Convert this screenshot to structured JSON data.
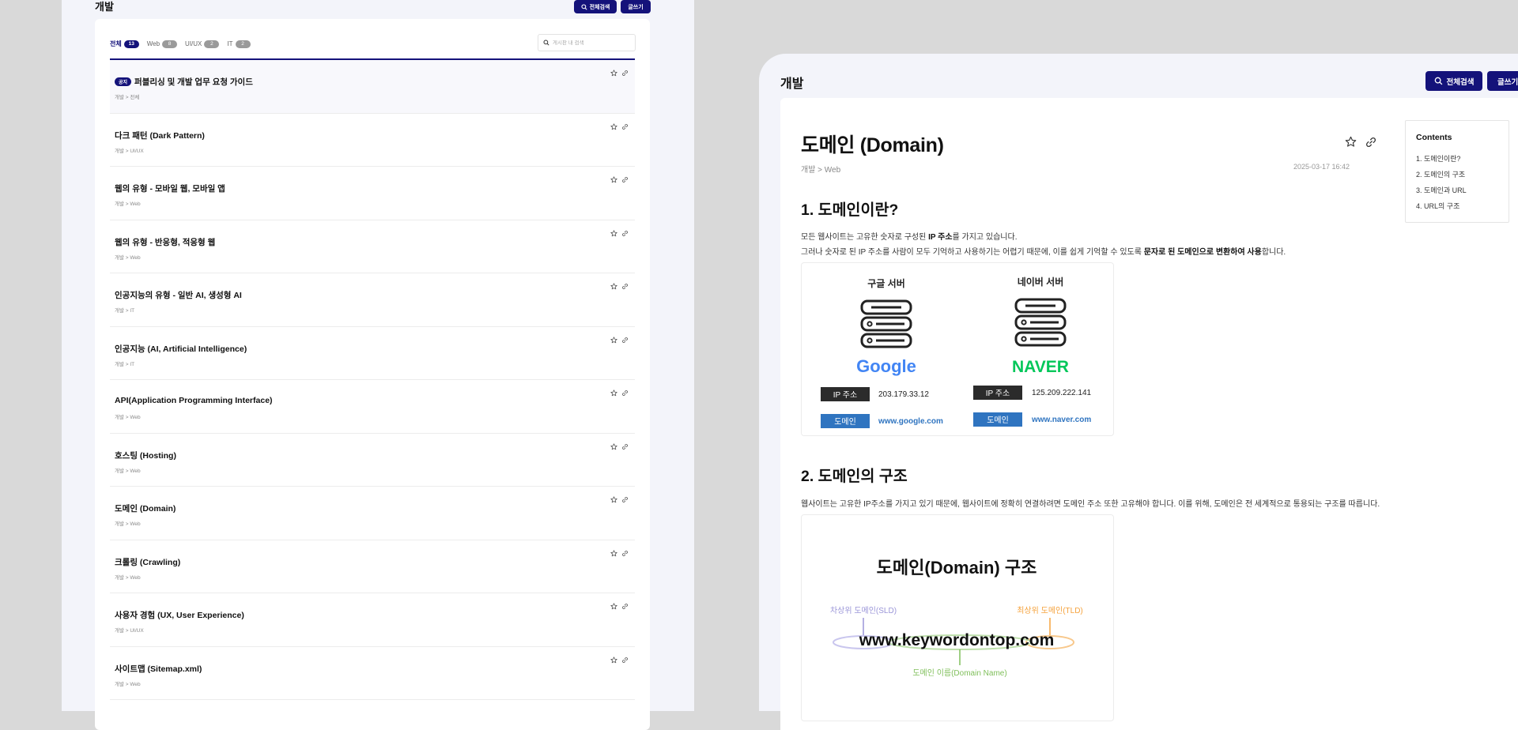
{
  "left": {
    "title": "개발",
    "search_button": "전체검색",
    "write_button": "글쓰기",
    "tabs": [
      {
        "label": "전체",
        "count": "13"
      },
      {
        "label": "Web",
        "count": "8"
      },
      {
        "label": "UI/UX",
        "count": "2"
      },
      {
        "label": "IT",
        "count": "2"
      }
    ],
    "search_placeholder": "게시판 내 검색",
    "notice_badge": "공지",
    "posts": [
      {
        "title": "퍼블리싱 및 개발 업무 요청 가이드",
        "crumb": "개발 > 전체",
        "notice": true
      },
      {
        "title": "다크 패턴 (Dark Pattern)",
        "crumb": "개발 > UI/UX"
      },
      {
        "title": "웹의 유형 - 모바일 웹, 모바일 앱",
        "crumb": "개발 > Web"
      },
      {
        "title": "웹의 유형 - 반응형, 적응형 웹",
        "crumb": "개발 > Web"
      },
      {
        "title": "인공지능의 유형 - 일반 AI, 생성형 AI",
        "crumb": "개발 > IT"
      },
      {
        "title": "인공지능 (AI, Artificial Intelligence)",
        "crumb": "개발 > IT"
      },
      {
        "title": "API(Application Programming Interface)",
        "crumb": "개발 > Web"
      },
      {
        "title": "호스팅 (Hosting)",
        "crumb": "개발 > Web"
      },
      {
        "title": "도메인 (Domain)",
        "crumb": "개발 > Web"
      },
      {
        "title": "크롤링 (Crawling)",
        "crumb": "개발 > Web"
      },
      {
        "title": "사용자 경험 (UX, User Experience)",
        "crumb": "개발 > UI/UX"
      },
      {
        "title": "사이트맵 (Sitemap.xml)",
        "crumb": "개발 > Web"
      }
    ]
  },
  "right": {
    "title": "개발",
    "search_button": "전체검색",
    "write_button": "글쓰기",
    "article": {
      "title": "도메인 (Domain)",
      "crumb": "개발 > Web",
      "date": "2025-03-17 16:42",
      "h1": "1. 도메인이란?",
      "p1_a": "모든 웹사이트는 고유한 숫자로 구성된 ",
      "p1_b": "IP 주소",
      "p1_c": "를 가지고 있습니다.",
      "p2_a": "그러나 숫자로 된 IP 주소를 사람이 모두 기억하고 사용하기는 어렵기 때문에, 이를 쉽게 기억할 수 있도록 ",
      "p2_b": "문자로 된 도메인으로 변환하여 사용",
      "p2_c": "합니다.",
      "h2": "2. 도메인의 구조",
      "p3": "웹사이트는 고유한 IP주소를 가지고 있기 때문에, 웹사이트에 정확히 연결하려면 도메인 주소 또한 고유해야 합니다. 이를 위해, 도메인은 전 세계적으로 통용되는 구조를 따릅니다."
    },
    "figure1": {
      "servers": [
        {
          "label": "구글 서버",
          "logo": "Google",
          "ip_tag": "IP 주소",
          "ip": "203.179.33.12",
          "domain_tag": "도메인",
          "domain": "www.google.com"
        },
        {
          "label": "네이버 서버",
          "logo": "NAVER",
          "ip_tag": "IP 주소",
          "ip": "125.209.222.141",
          "domain_tag": "도메인",
          "domain": "www.naver.com"
        }
      ]
    },
    "figure2": {
      "title": "도메인(Domain) 구조",
      "sld_label": "차상위 도메인(SLD)",
      "tld_label": "최상위 도메인(TLD)",
      "url": "www.keywordontop.com",
      "name_label": "도메인 이름(Domain Name)"
    },
    "toc": {
      "title": "Contents",
      "items": [
        "1. 도메인이란?",
        "2. 도메인의 구조",
        "3. 도메인과 URL",
        "4. URL의 구조"
      ]
    }
  },
  "colors": {
    "navy": "#14127a",
    "google_blue": "#4285f4",
    "naver_green": "#03c75a",
    "domain_tag_blue": "#2f74c0",
    "sld_purple": "#9a95d8",
    "tld_orange": "#f5a23c",
    "name_green": "#7fbf5a"
  }
}
